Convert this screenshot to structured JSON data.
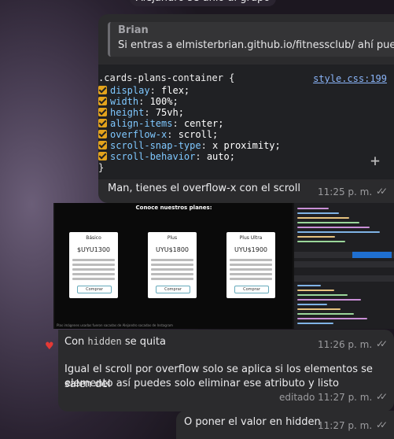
{
  "system_message": "Alejandro se unió al grupo",
  "reply": {
    "name": "Brian",
    "text": "Si entras a elmisterbrian.github.io/fitnessclub/ ahí pue..."
  },
  "code_snippet": {
    "selector": ".cards-plans-container {",
    "source_link": "style.css:199",
    "properties": [
      {
        "name": "display",
        "value": "flex;"
      },
      {
        "name": "width",
        "value": "100%;"
      },
      {
        "name": "height",
        "value": "75vh;"
      },
      {
        "name": "align-items",
        "value": "center;"
      },
      {
        "name": "overflow-x",
        "value": "scroll;"
      },
      {
        "name": "scroll-snap-type",
        "value": "x proximity;"
      },
      {
        "name": "scroll-behavior",
        "value": "auto;"
      }
    ],
    "closing": "}",
    "add_icon": "+"
  },
  "messages": {
    "m1": {
      "text": "Man, tienes el overflow-x con el scroll",
      "time": "11:25 p. m."
    },
    "m2": {
      "text_before": "Con ",
      "code": "hidden",
      "text_after": " se quita",
      "time": "11:26 p. m."
    },
    "m3": {
      "line1": "Igual el scroll por overflow solo se aplica si los elementos se salen del",
      "line2": "elemento así puedes solo eliminar ese atributo y listo",
      "edited_time": "editado 11:27 p. m."
    },
    "m4": {
      "text": "O poner el valor en hidden",
      "time": "11:27 p. m."
    }
  },
  "screenshot": {
    "title": "Conoce nuestros planes:",
    "cards": [
      {
        "name": "Básico",
        "price": "$UYU1300",
        "button": "Comprar"
      },
      {
        "name": "Plus",
        "price": "UYU$1800",
        "button": "Comprar"
      },
      {
        "name": "Plus Ultra",
        "price": "UYU$1900",
        "button": "Comprar"
      }
    ],
    "footer": "Plas imágenes usadas fueron sacadas de Alejandro sacadas de Instagram"
  },
  "reaction_icon": "heart-icon",
  "read_ticks": "✓✓",
  "colors": {
    "link": "#8ab4f8",
    "checkbox": "#e3a31c",
    "bubble": "#2b2b2d",
    "heart": "#e53935"
  }
}
